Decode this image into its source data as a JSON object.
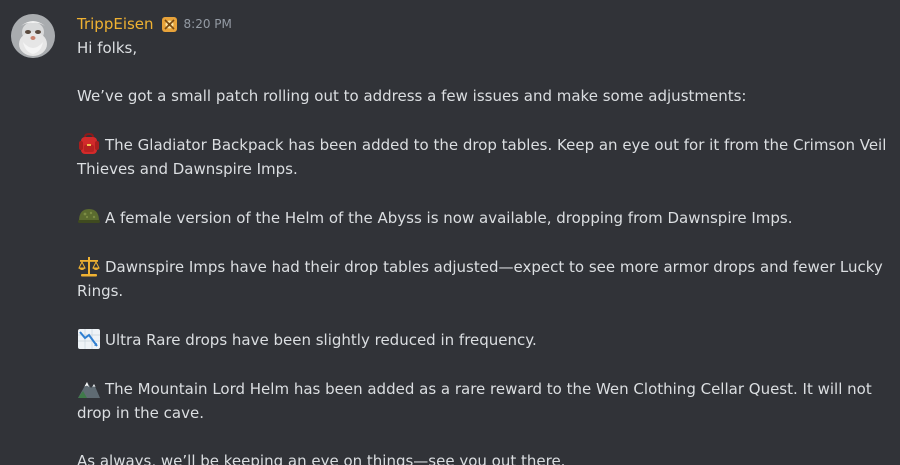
{
  "message": {
    "username": "TrippEisen",
    "timestamp": "8:20 PM",
    "greeting": "Hi folks,",
    "intro": "We’ve got a small patch rolling out to address a few issues and make some adjustments:",
    "items": [
      {
        "icon": "red-backpack-icon",
        "text": "The Gladiator Backpack has been added to the drop tables. Keep an eye out for it from the Crimson Veil Thieves and Dawnspire Imps."
      },
      {
        "icon": "military-helmet-icon",
        "text": "A female version of the Helm of the Abyss is now available, dropping from Dawnspire Imps."
      },
      {
        "icon": "balance-scale-icon",
        "text": "Dawnspire Imps have had their drop tables adjusted—expect to see more armor drops and fewer Lucky Rings."
      },
      {
        "icon": "chart-decreasing-icon",
        "text": "Ultra Rare drops have been slightly reduced in frequency."
      },
      {
        "icon": "mountain-icon",
        "text": "The Mountain Lord Helm has been added as a rare reward to the Wen Clothing Cellar Quest. It will not drop in the cave."
      }
    ],
    "closing": "As always, we’ll be keeping an eye on things—see you out there."
  },
  "colors": {
    "background": "#313338",
    "username": "#f0b232",
    "text": "#dbdee1",
    "timestamp": "#949ba4"
  }
}
